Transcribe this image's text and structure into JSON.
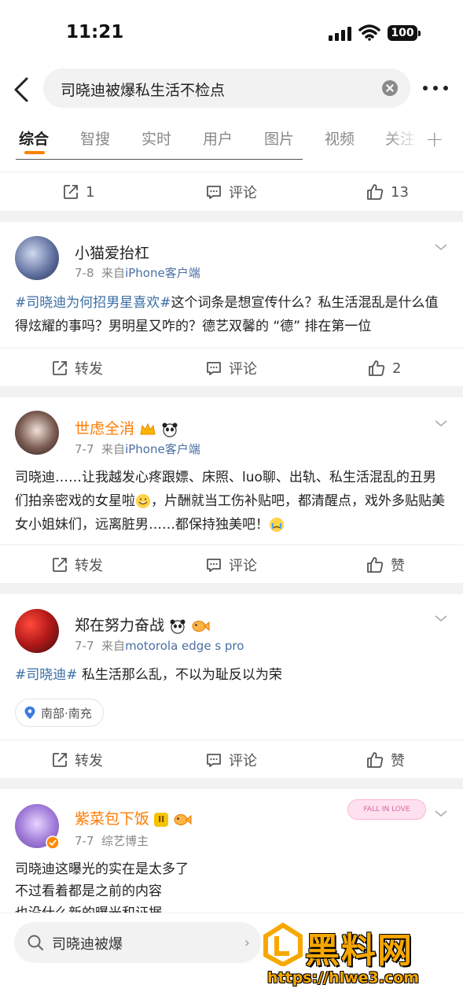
{
  "status_bar": {
    "time": "11:21",
    "battery": "100"
  },
  "search": {
    "query": "司晓迪被爆私生活不检点"
  },
  "tabs": [
    {
      "label": "综合"
    },
    {
      "label": "智搜"
    },
    {
      "label": "实时"
    },
    {
      "label": "用户"
    },
    {
      "label": "图片"
    },
    {
      "label": "视频"
    },
    {
      "label": "关注"
    }
  ],
  "top_actions": {
    "repost": "1",
    "comment": "评论",
    "like": "13"
  },
  "posts": [
    {
      "user": "小猫爱抬杠",
      "date": "7-8",
      "from_prefix": "来自",
      "source": "iPhone客户端",
      "hashtag": "#司晓迪为何招男星喜欢#",
      "text": "这个词条是想宣传什么？私生活混乱是什么值得炫耀的事吗？男明星又咋的？德艺双馨的 “德” 排在第一位",
      "actions": {
        "repost": "转发",
        "comment": "评论",
        "like": "2"
      }
    },
    {
      "user": "世虑全消",
      "date": "7-7",
      "from_prefix": "来自",
      "source": "iPhone客户端",
      "text": "司晓迪……让我越发心疼跟嫖、床照、luo聊、出轨、私生活混乱的丑男们拍亲密戏的女星啦",
      "text2": "，片酬就当工伤补贴吧，都清醒点，戏外多贴贴美女小姐妹们，远离脏男……都保持独美吧！",
      "actions": {
        "repost": "转发",
        "comment": "评论",
        "like": "赞"
      }
    },
    {
      "user": "郑在努力奋战",
      "date": "7-7",
      "from_prefix": "来自",
      "source": "motorola edge s pro",
      "hashtag": "#司晓迪#",
      "text": " 私生活那么乱，不以为耻反以为荣",
      "location": "南部·南充",
      "actions": {
        "repost": "转发",
        "comment": "评论",
        "like": "赞"
      }
    },
    {
      "user": "紫菜包下饭",
      "level": "II",
      "date": "7-7",
      "role": "综艺博主",
      "sticker": "FALL IN LOVE",
      "lines": [
        "司晓迪这曝光的实在是太多了",
        "不过看着都是之前的内容",
        "也没什么新的曝光和证据"
      ]
    }
  ],
  "bottom_search": {
    "query": "司晓迪被爆"
  },
  "watermark": {
    "text": "黑料网",
    "url": "https://hlwe3.com"
  },
  "colors": {
    "accent": "#ff8200",
    "link": "#3a6ea5",
    "vip_name": "#ff7a00"
  }
}
